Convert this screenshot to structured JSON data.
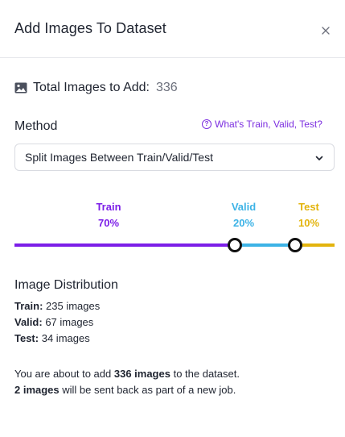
{
  "dialog": {
    "title": "Add Images To Dataset",
    "close_icon": "close-icon"
  },
  "total": {
    "icon": "image-icon",
    "label": "Total Images to Add:",
    "value": "336"
  },
  "method": {
    "label": "Method",
    "help_icon": "question-circle-icon",
    "help_link": "What's Train, Valid, Test?",
    "selected": "Split Images Between Train/Valid/Test"
  },
  "split": {
    "train": {
      "label": "Train",
      "percent": "70%",
      "color": "#7c1ee8"
    },
    "valid": {
      "label": "Valid",
      "percent": "20%",
      "color": "#3db3e6"
    },
    "test": {
      "label": "Test",
      "percent": "10%",
      "color": "#e3b40d"
    }
  },
  "distribution": {
    "title": "Image Distribution",
    "rows": [
      {
        "label": "Train:",
        "value": "235 images"
      },
      {
        "label": "Valid:",
        "value": "67 images"
      },
      {
        "label": "Test:",
        "value": "34 images"
      }
    ]
  },
  "summary": {
    "line1_prefix": "You are about to add ",
    "line1_bold": "336 images",
    "line1_suffix": " to the dataset.",
    "line2_bold": "2 images",
    "line2_suffix": " will be sent back as part of a new job."
  }
}
